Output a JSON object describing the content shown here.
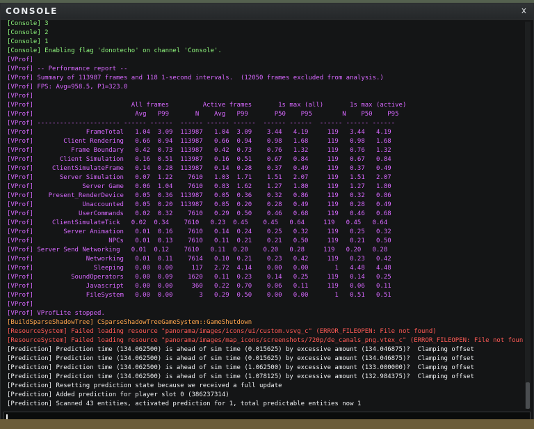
{
  "window": {
    "title": "CONSOLE",
    "close_label": "x"
  },
  "log_lines": [
    {
      "text": "[Console] 3",
      "color": "green"
    },
    {
      "text": "[Console] 2",
      "color": "green"
    },
    {
      "text": "[Console] 1",
      "color": "green"
    },
    {
      "text": "[Console] Enabling flag 'donotecho' on channel 'Console'.",
      "color": "green"
    },
    {
      "text": "[VProf]",
      "color": "purple"
    },
    {
      "text": "[VProf] -- Performance report --",
      "color": "purple"
    },
    {
      "text": "[VProf] Summary of 113987 frames and 118 1-second intervals.  (12050 frames excluded from analysis.)",
      "color": "purple"
    },
    {
      "text": "[VProf] FPS: Avg=958.5, P1=323.0",
      "color": "purple"
    },
    {
      "text": "[VProf]",
      "color": "purple"
    },
    {
      "text": "[VProf]                          All frames         Active frames       1s max (all)       1s max (active)",
      "color": "purple"
    },
    {
      "text": "[VProf]                           Avg   P99       N    Avg   P99       P50    P95        N    P50    P95",
      "color": "purple"
    },
    {
      "text": "[VProf] ---------------------- ------ ------  ------ ------ ------  ------ ------  ------ ------ ------",
      "color": "purple"
    },
    {
      "text": "[VProf]              FrameTotal   1.04  3.09  113987   1.04  3.09    3.44   4.19     119   3.44   4.19",
      "color": "purple"
    },
    {
      "text": "[VProf]        Client Rendering   0.66  0.94  113987   0.66  0.94    0.98   1.68     119   0.98   1.68",
      "color": "purple"
    },
    {
      "text": "[VProf]          Frame Boundary   0.42  0.73  113987   0.42  0.73    0.76   1.32     119   0.76   1.32",
      "color": "purple"
    },
    {
      "text": "[VProf]       Client Simulation   0.16  0.51  113987   0.16  0.51    0.67   0.84     119   0.67   0.84",
      "color": "purple"
    },
    {
      "text": "[VProf]     ClientSimulateFrame   0.14  0.28  113987   0.14  0.28    0.37   0.49     119   0.37   0.49",
      "color": "purple"
    },
    {
      "text": "[VProf]       Server Simulation   0.07  1.22    7610   1.03  1.71    1.51   2.07     119   1.51   2.07",
      "color": "purple"
    },
    {
      "text": "[VProf]             Server Game   0.06  1.04    7610   0.83  1.62    1.27   1.80     119   1.27   1.80",
      "color": "purple"
    },
    {
      "text": "[VProf]    Present_RenderDevice   0.05  0.36  113987   0.05  0.36    0.32   0.86     119   0.32   0.86",
      "color": "purple"
    },
    {
      "text": "[VProf]             Unaccounted   0.05  0.20  113987   0.05  0.20    0.28   0.49     119   0.28   0.49",
      "color": "purple"
    },
    {
      "text": "[VProf]            UserCommands   0.02  0.32    7610   0.29  0.50    0.46   0.68     119   0.46   0.68",
      "color": "purple"
    },
    {
      "text": "[VProf]     ClientSimulateTick   0.02  0.34    7610   0.23  0.45    0.45   0.64     119   0.45   0.64",
      "color": "purple"
    },
    {
      "text": "[VProf]        Server Animation   0.01  0.16    7610   0.14  0.24    0.25   0.32     119   0.25   0.32",
      "color": "purple"
    },
    {
      "text": "[VProf]                    NPCs   0.01  0.13    7610   0.11  0.21    0.21   0.50     119   0.21   0.50",
      "color": "purple"
    },
    {
      "text": "[VProf] Server Send Networking   0.01  0.12    7610   0.11  0.20    0.20   0.28     119   0.20   0.28",
      "color": "purple"
    },
    {
      "text": "[VProf]              Networking   0.01  0.11    7614   0.10  0.21    0.23   0.42     119   0.23   0.42",
      "color": "purple"
    },
    {
      "text": "[VProf]                Sleeping   0.00  0.00     117   2.72  4.14    0.00   0.00       1   4.48   4.48",
      "color": "purple"
    },
    {
      "text": "[VProf]          SoundOperators   0.00  0.09    1620   0.11  0.23    0.14   0.25     119   0.14   0.25",
      "color": "purple"
    },
    {
      "text": "[VProf]              Javascript   0.00  0.00     360   0.22  0.70    0.06   0.11     119   0.06   0.11",
      "color": "purple"
    },
    {
      "text": "[VProf]              FileSystem   0.00  0.00       3   0.29  0.50    0.00   0.00       1   0.51   0.51",
      "color": "purple"
    },
    {
      "text": "[VProf]",
      "color": "purple"
    },
    {
      "text": "[VProf] VProfLite stopped.",
      "color": "purple"
    },
    {
      "text": "[BuildSparseShadowTree] CSparseShadowTreeGameSystem::GameShutdown",
      "color": "orange"
    },
    {
      "text": "[ResourceSystem] Failed loading resource \"panorama/images/icons/ui/custom.vsvg_c\" (ERROR_FILEOPEN: File not found)",
      "color": "red"
    },
    {
      "text": "[ResourceSystem] Failed loading resource \"panorama/images/map_icons/screenshots/720p/de_canals_png.vtex_c\" (ERROR_FILEOPEN: File not found)",
      "color": "red"
    },
    {
      "text": "[Prediction] Prediction time (134.062500) is ahead of sim time (0.015625) by excessive amount (134.046875)?  Clamping offset",
      "color": "white"
    },
    {
      "text": "[Prediction] Prediction time (134.062500) is ahead of sim time (0.015625) by excessive amount (134.046875)?  Clamping offset",
      "color": "white"
    },
    {
      "text": "[Prediction] Prediction time (134.062500) is ahead of sim time (1.062500) by excessive amount (133.000000)?  Clamping offset",
      "color": "white"
    },
    {
      "text": "[Prediction] Prediction time (134.062500) is ahead of sim time (1.078125) by excessive amount (132.984375)?  Clamping offset",
      "color": "white"
    },
    {
      "text": "[Prediction] Resetting prediction state because we received a full update",
      "color": "white"
    },
    {
      "text": "[Prediction] Added prediction for player slot 0 (386237314)",
      "color": "white"
    },
    {
      "text": "[Prediction] Scanned 43 entities, activated prediction for 1, total predictable entities now 1",
      "color": "white"
    }
  ],
  "input": {
    "value": ""
  },
  "colors": {
    "green": "#8ef57c",
    "purple": "#d768ff",
    "orange": "#ffa64d",
    "red": "#ff5a55",
    "white": "#eef0f2"
  }
}
